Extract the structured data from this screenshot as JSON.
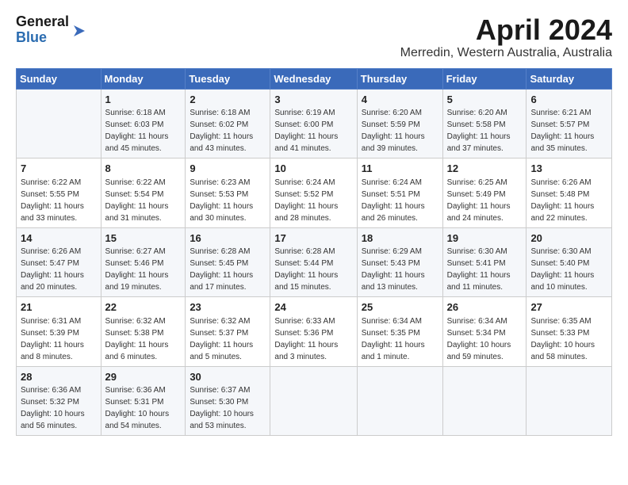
{
  "header": {
    "logo_line1": "General",
    "logo_line2": "Blue",
    "month_title": "April 2024",
    "location": "Merredin, Western Australia, Australia"
  },
  "weekdays": [
    "Sunday",
    "Monday",
    "Tuesday",
    "Wednesday",
    "Thursday",
    "Friday",
    "Saturday"
  ],
  "weeks": [
    [
      {
        "day": "",
        "sunrise": "",
        "sunset": "",
        "daylight": ""
      },
      {
        "day": "1",
        "sunrise": "Sunrise: 6:18 AM",
        "sunset": "Sunset: 6:03 PM",
        "daylight": "Daylight: 11 hours and 45 minutes."
      },
      {
        "day": "2",
        "sunrise": "Sunrise: 6:18 AM",
        "sunset": "Sunset: 6:02 PM",
        "daylight": "Daylight: 11 hours and 43 minutes."
      },
      {
        "day": "3",
        "sunrise": "Sunrise: 6:19 AM",
        "sunset": "Sunset: 6:00 PM",
        "daylight": "Daylight: 11 hours and 41 minutes."
      },
      {
        "day": "4",
        "sunrise": "Sunrise: 6:20 AM",
        "sunset": "Sunset: 5:59 PM",
        "daylight": "Daylight: 11 hours and 39 minutes."
      },
      {
        "day": "5",
        "sunrise": "Sunrise: 6:20 AM",
        "sunset": "Sunset: 5:58 PM",
        "daylight": "Daylight: 11 hours and 37 minutes."
      },
      {
        "day": "6",
        "sunrise": "Sunrise: 6:21 AM",
        "sunset": "Sunset: 5:57 PM",
        "daylight": "Daylight: 11 hours and 35 minutes."
      }
    ],
    [
      {
        "day": "7",
        "sunrise": "Sunrise: 6:22 AM",
        "sunset": "Sunset: 5:55 PM",
        "daylight": "Daylight: 11 hours and 33 minutes."
      },
      {
        "day": "8",
        "sunrise": "Sunrise: 6:22 AM",
        "sunset": "Sunset: 5:54 PM",
        "daylight": "Daylight: 11 hours and 31 minutes."
      },
      {
        "day": "9",
        "sunrise": "Sunrise: 6:23 AM",
        "sunset": "Sunset: 5:53 PM",
        "daylight": "Daylight: 11 hours and 30 minutes."
      },
      {
        "day": "10",
        "sunrise": "Sunrise: 6:24 AM",
        "sunset": "Sunset: 5:52 PM",
        "daylight": "Daylight: 11 hours and 28 minutes."
      },
      {
        "day": "11",
        "sunrise": "Sunrise: 6:24 AM",
        "sunset": "Sunset: 5:51 PM",
        "daylight": "Daylight: 11 hours and 26 minutes."
      },
      {
        "day": "12",
        "sunrise": "Sunrise: 6:25 AM",
        "sunset": "Sunset: 5:49 PM",
        "daylight": "Daylight: 11 hours and 24 minutes."
      },
      {
        "day": "13",
        "sunrise": "Sunrise: 6:26 AM",
        "sunset": "Sunset: 5:48 PM",
        "daylight": "Daylight: 11 hours and 22 minutes."
      }
    ],
    [
      {
        "day": "14",
        "sunrise": "Sunrise: 6:26 AM",
        "sunset": "Sunset: 5:47 PM",
        "daylight": "Daylight: 11 hours and 20 minutes."
      },
      {
        "day": "15",
        "sunrise": "Sunrise: 6:27 AM",
        "sunset": "Sunset: 5:46 PM",
        "daylight": "Daylight: 11 hours and 19 minutes."
      },
      {
        "day": "16",
        "sunrise": "Sunrise: 6:28 AM",
        "sunset": "Sunset: 5:45 PM",
        "daylight": "Daylight: 11 hours and 17 minutes."
      },
      {
        "day": "17",
        "sunrise": "Sunrise: 6:28 AM",
        "sunset": "Sunset: 5:44 PM",
        "daylight": "Daylight: 11 hours and 15 minutes."
      },
      {
        "day": "18",
        "sunrise": "Sunrise: 6:29 AM",
        "sunset": "Sunset: 5:43 PM",
        "daylight": "Daylight: 11 hours and 13 minutes."
      },
      {
        "day": "19",
        "sunrise": "Sunrise: 6:30 AM",
        "sunset": "Sunset: 5:41 PM",
        "daylight": "Daylight: 11 hours and 11 minutes."
      },
      {
        "day": "20",
        "sunrise": "Sunrise: 6:30 AM",
        "sunset": "Sunset: 5:40 PM",
        "daylight": "Daylight: 11 hours and 10 minutes."
      }
    ],
    [
      {
        "day": "21",
        "sunrise": "Sunrise: 6:31 AM",
        "sunset": "Sunset: 5:39 PM",
        "daylight": "Daylight: 11 hours and 8 minutes."
      },
      {
        "day": "22",
        "sunrise": "Sunrise: 6:32 AM",
        "sunset": "Sunset: 5:38 PM",
        "daylight": "Daylight: 11 hours and 6 minutes."
      },
      {
        "day": "23",
        "sunrise": "Sunrise: 6:32 AM",
        "sunset": "Sunset: 5:37 PM",
        "daylight": "Daylight: 11 hours and 5 minutes."
      },
      {
        "day": "24",
        "sunrise": "Sunrise: 6:33 AM",
        "sunset": "Sunset: 5:36 PM",
        "daylight": "Daylight: 11 hours and 3 minutes."
      },
      {
        "day": "25",
        "sunrise": "Sunrise: 6:34 AM",
        "sunset": "Sunset: 5:35 PM",
        "daylight": "Daylight: 11 hours and 1 minute."
      },
      {
        "day": "26",
        "sunrise": "Sunrise: 6:34 AM",
        "sunset": "Sunset: 5:34 PM",
        "daylight": "Daylight: 10 hours and 59 minutes."
      },
      {
        "day": "27",
        "sunrise": "Sunrise: 6:35 AM",
        "sunset": "Sunset: 5:33 PM",
        "daylight": "Daylight: 10 hours and 58 minutes."
      }
    ],
    [
      {
        "day": "28",
        "sunrise": "Sunrise: 6:36 AM",
        "sunset": "Sunset: 5:32 PM",
        "daylight": "Daylight: 10 hours and 56 minutes."
      },
      {
        "day": "29",
        "sunrise": "Sunrise: 6:36 AM",
        "sunset": "Sunset: 5:31 PM",
        "daylight": "Daylight: 10 hours and 54 minutes."
      },
      {
        "day": "30",
        "sunrise": "Sunrise: 6:37 AM",
        "sunset": "Sunset: 5:30 PM",
        "daylight": "Daylight: 10 hours and 53 minutes."
      },
      {
        "day": "",
        "sunrise": "",
        "sunset": "",
        "daylight": ""
      },
      {
        "day": "",
        "sunrise": "",
        "sunset": "",
        "daylight": ""
      },
      {
        "day": "",
        "sunrise": "",
        "sunset": "",
        "daylight": ""
      },
      {
        "day": "",
        "sunrise": "",
        "sunset": "",
        "daylight": ""
      }
    ]
  ]
}
